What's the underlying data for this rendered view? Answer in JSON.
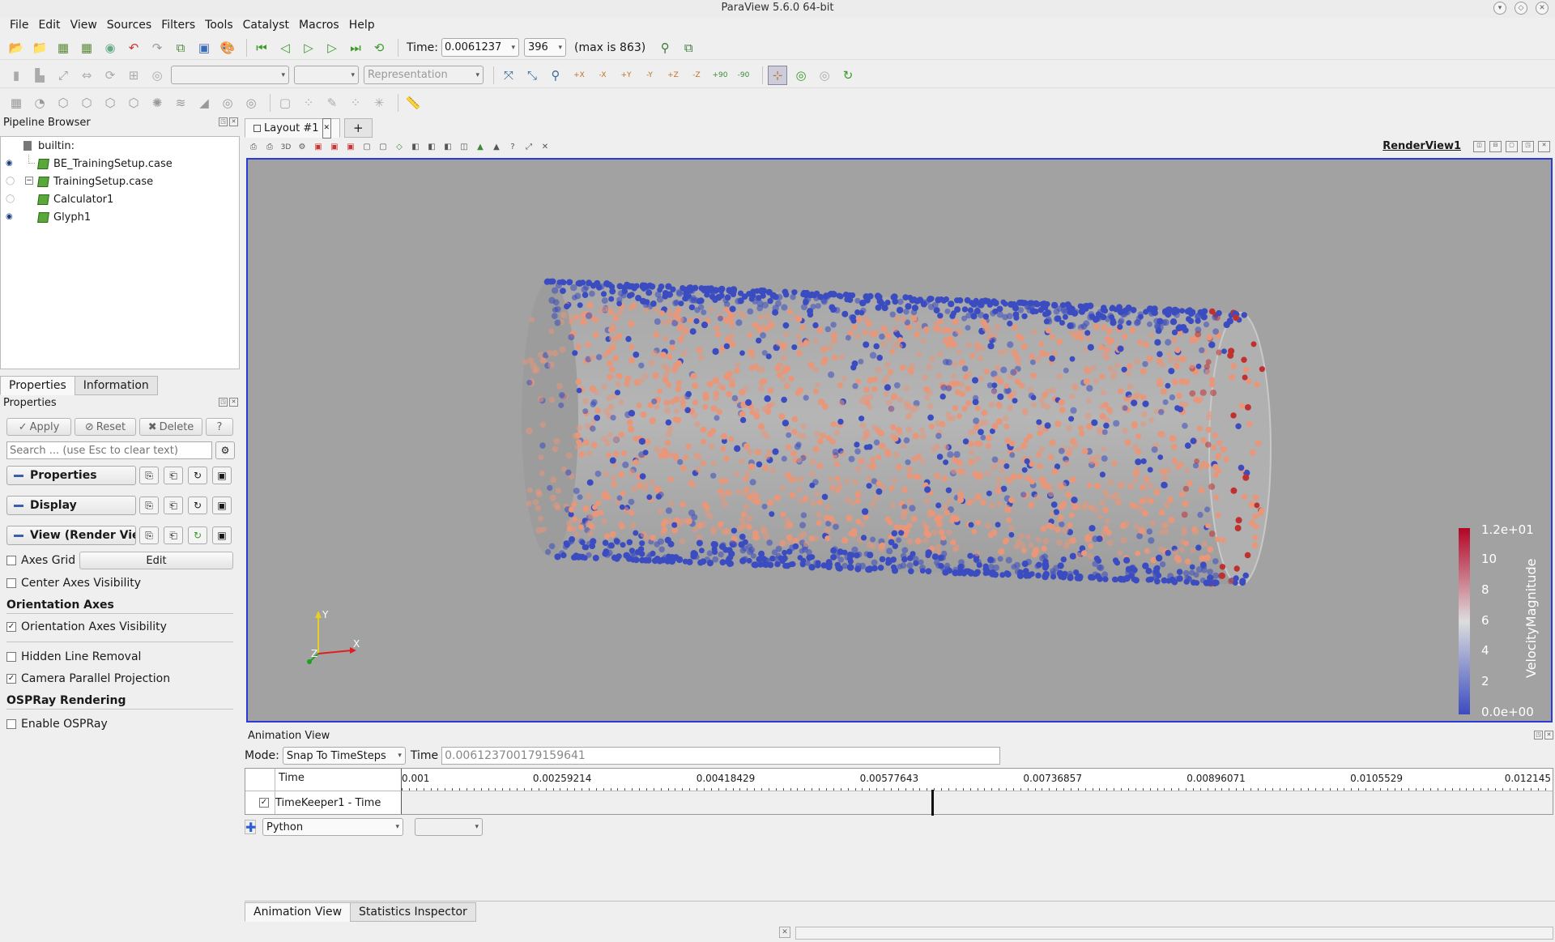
{
  "window": {
    "title": "ParaView 5.6.0 64-bit"
  },
  "menu": [
    {
      "label": "File"
    },
    {
      "label": "Edit"
    },
    {
      "label": "View"
    },
    {
      "label": "Sources"
    },
    {
      "label": "Filters"
    },
    {
      "label": "Tools"
    },
    {
      "label": "Catalyst"
    },
    {
      "label": "Macros"
    },
    {
      "label": "Help"
    }
  ],
  "toolbar": {
    "time_label": "Time:",
    "time_value": "0.0061237",
    "timestep": "396",
    "max_label": "(max is 863)",
    "representation_placeholder": "Representation",
    "camera_labels": [
      "+X",
      "-X",
      "+Y",
      "-Y",
      "+Z",
      "-Z",
      "+90",
      "-90"
    ],
    "icon_3d": "3D"
  },
  "pipeline": {
    "title": "Pipeline Browser",
    "root": "builtin:",
    "items": [
      {
        "label": "BE_TrainingSetup.case",
        "visible": true
      },
      {
        "label": "TrainingSetup.case",
        "visible": false
      },
      {
        "label": "Calculator1",
        "visible": false
      },
      {
        "label": "Glyph1",
        "visible": true
      }
    ]
  },
  "panel_tabs": [
    {
      "label": "Properties"
    },
    {
      "label": "Information"
    }
  ],
  "properties": {
    "title": "Properties",
    "apply": "Apply",
    "reset": "Reset",
    "delete": "Delete",
    "help": "?",
    "search_placeholder": "Search ... (use Esc to clear text)",
    "sections": [
      {
        "label": "Properties"
      },
      {
        "label": "Display"
      },
      {
        "label": "View (Render View)"
      }
    ],
    "axes_grid": "Axes Grid",
    "edit": "Edit",
    "center_axes": "Center Axes Visibility",
    "orientation_header": "Orientation Axes",
    "orientation_visibility": "Orientation Axes Visibility",
    "hidden_line": "Hidden Line Removal",
    "camera_parallel": "Camera Parallel Projection",
    "ospray_header": "OSPRay Rendering",
    "enable_ospray": "Enable OSPRay"
  },
  "layout": {
    "tab": "Layout #1",
    "add": "+",
    "view_name": "RenderView1"
  },
  "colorbar": {
    "title": "VelocityMagnitude",
    "labels": [
      "1.2e+01",
      "10",
      "8",
      "6",
      "4",
      "2",
      "0.0e+00"
    ]
  },
  "orientation_axes": {
    "x": "X",
    "y": "Y",
    "z": "Z"
  },
  "animation": {
    "title": "Animation View",
    "mode_label": "Mode:",
    "mode_value": "Snap To TimeSteps",
    "time_label": "Time",
    "time_value": "0.006123700179159641",
    "col_time": "Time",
    "ticks": [
      "0.001",
      "0.00259214",
      "0.00418429",
      "0.00577643",
      "0.00736857",
      "0.00896071",
      "0.0105529",
      "0.012145"
    ],
    "current_time_fraction": 0.46,
    "track": "TimeKeeper1 - Time",
    "python": "Python"
  },
  "bottom_tabs": [
    {
      "label": "Animation View"
    },
    {
      "label": "Statistics Inspector"
    }
  ],
  "colors": {
    "accent": "#2b3bd8",
    "particle_low": "#3a4cc0",
    "particle_high": "#e8977a",
    "background": "#a2a2a2"
  }
}
